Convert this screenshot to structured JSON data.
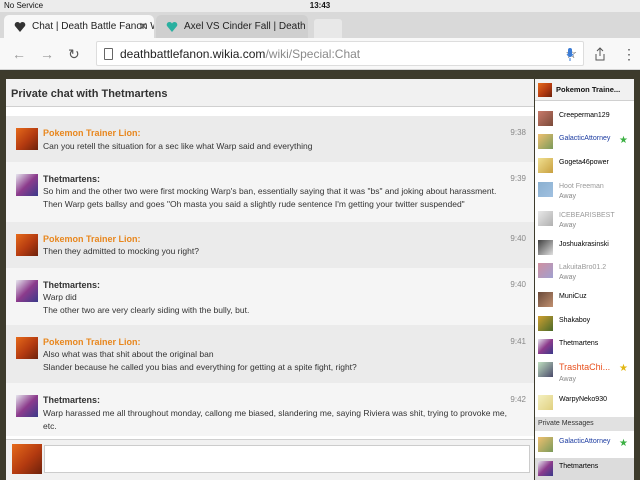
{
  "status_bar": {
    "carrier": "No Service",
    "time": "13:43"
  },
  "tabs": [
    {
      "title": "Chat | Death Battle Fanon Wi",
      "active": true
    },
    {
      "title": "Axel VS Cinder Fall | Death B",
      "active": false
    }
  ],
  "address_bar": {
    "host": "deathbattlefanon.wikia.com",
    "path": "/wiki/Special:Chat"
  },
  "icons": {
    "back": "back-arrow-icon",
    "forward": "forward-arrow-icon",
    "reload": "reload-icon",
    "page": "page-icon",
    "bookmark": "star-icon",
    "voice": "microphone-icon",
    "share": "share-icon",
    "menu": "more-vert-icon"
  },
  "chat": {
    "title": "Private chat with Thetmartens",
    "messages": [
      {
        "author": "Pokemon Trainer Lion:",
        "time": "9:38",
        "lines": [
          "Can you retell the situation for a sec like what Warp said and everything"
        ]
      },
      {
        "author": "Thetmartens:",
        "time": "9:39",
        "lines": [
          "So him and the other two were first mocking Warp's ban, essentially saying that it was \"bs\" and joking about harassment.",
          "Then Warp gets ballsy and goes \"Oh masta you said a slightly rude sentence I'm getting your twitter suspended\""
        ]
      },
      {
        "author": "Pokemon Trainer Lion:",
        "time": "9:40",
        "lines": [
          "Then they admitted to mocking you right?"
        ]
      },
      {
        "author": "Thetmartens:",
        "time": "9:40",
        "lines": [
          "Warp did",
          "The other two are very clearly siding with the bully, but."
        ]
      },
      {
        "author": "Pokemon Trainer Lion:",
        "time": "9:41",
        "lines": [
          "Also what was that shit about the original ban",
          "Slander because he called you bias and everything for getting at a spite fight, right?"
        ]
      },
      {
        "author": "Thetmartens:",
        "time": "9:42",
        "lines": [
          "Warp harassed me all throughout monday, callong me biased, slandering me, saying Riviera was shit, trying to provoke me,",
          "etc."
        ]
      }
    ]
  },
  "sidebar": {
    "current_user": "Pokemon Traine...",
    "users": [
      {
        "name": "Creeperman129",
        "status": "",
        "color": "#333333",
        "badge": ""
      },
      {
        "name": "GalacticAttorney",
        "status": "",
        "color": "#1a3aa0",
        "badge": "green-star-icon"
      },
      {
        "name": "Gogeta46power",
        "status": "",
        "color": "#333333",
        "badge": ""
      },
      {
        "name": "Hoot Freeman",
        "status": "Away",
        "color": "#999999",
        "badge": ""
      },
      {
        "name": "ICEBEARISBEST",
        "status": "Away",
        "color": "#999999",
        "badge": ""
      },
      {
        "name": "Joshuakrasinski",
        "status": "",
        "color": "#333333",
        "badge": ""
      },
      {
        "name": "LakuitaBro01.2",
        "status": "Away",
        "color": "#999999",
        "badge": ""
      },
      {
        "name": "MuniCuz",
        "status": "",
        "color": "#333333",
        "badge": ""
      },
      {
        "name": "Shakaboy",
        "status": "",
        "color": "#333333",
        "badge": ""
      },
      {
        "name": "Thetmartens",
        "status": "",
        "color": "#333333",
        "badge": ""
      },
      {
        "name": "TrashtaChi...",
        "status": "Away",
        "color": "#e8511e",
        "badge": "gold-star-icon"
      },
      {
        "name": "WarpyNeko930",
        "status": "",
        "color": "#333333",
        "badge": ""
      }
    ],
    "private_messages_label": "Private Messages",
    "private": [
      {
        "name": "GalacticAttorney",
        "color": "#1a3aa0",
        "badge": "green-star-icon"
      },
      {
        "name": "Thetmartens",
        "color": "#333333",
        "badge": ""
      }
    ]
  }
}
